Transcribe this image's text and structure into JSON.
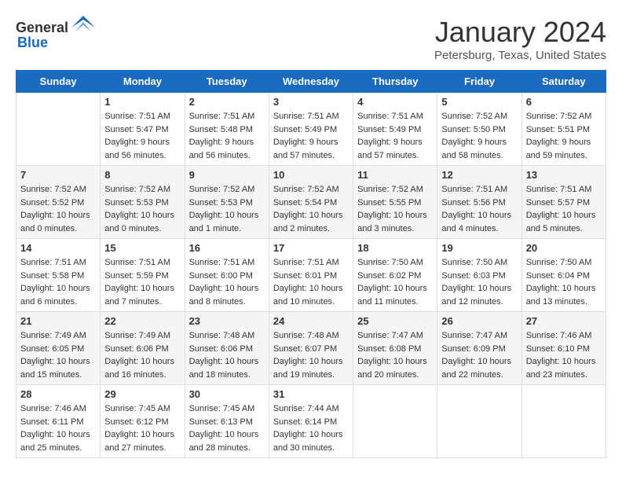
{
  "header": {
    "logo_general": "General",
    "logo_blue": "Blue",
    "month": "January 2024",
    "location": "Petersburg, Texas, United States"
  },
  "days_of_week": [
    "Sunday",
    "Monday",
    "Tuesday",
    "Wednesday",
    "Thursday",
    "Friday",
    "Saturday"
  ],
  "weeks": [
    [
      {
        "day": "",
        "content": ""
      },
      {
        "day": "1",
        "content": "Sunrise: 7:51 AM\nSunset: 5:47 PM\nDaylight: 9 hours\nand 56 minutes."
      },
      {
        "day": "2",
        "content": "Sunrise: 7:51 AM\nSunset: 5:48 PM\nDaylight: 9 hours\nand 56 minutes."
      },
      {
        "day": "3",
        "content": "Sunrise: 7:51 AM\nSunset: 5:49 PM\nDaylight: 9 hours\nand 57 minutes."
      },
      {
        "day": "4",
        "content": "Sunrise: 7:51 AM\nSunset: 5:49 PM\nDaylight: 9 hours\nand 57 minutes."
      },
      {
        "day": "5",
        "content": "Sunrise: 7:52 AM\nSunset: 5:50 PM\nDaylight: 9 hours\nand 58 minutes."
      },
      {
        "day": "6",
        "content": "Sunrise: 7:52 AM\nSunset: 5:51 PM\nDaylight: 9 hours\nand 59 minutes."
      }
    ],
    [
      {
        "day": "7",
        "content": "Sunrise: 7:52 AM\nSunset: 5:52 PM\nDaylight: 10 hours\nand 0 minutes."
      },
      {
        "day": "8",
        "content": "Sunrise: 7:52 AM\nSunset: 5:53 PM\nDaylight: 10 hours\nand 0 minutes."
      },
      {
        "day": "9",
        "content": "Sunrise: 7:52 AM\nSunset: 5:53 PM\nDaylight: 10 hours\nand 1 minute."
      },
      {
        "day": "10",
        "content": "Sunrise: 7:52 AM\nSunset: 5:54 PM\nDaylight: 10 hours\nand 2 minutes."
      },
      {
        "day": "11",
        "content": "Sunrise: 7:52 AM\nSunset: 5:55 PM\nDaylight: 10 hours\nand 3 minutes."
      },
      {
        "day": "12",
        "content": "Sunrise: 7:51 AM\nSunset: 5:56 PM\nDaylight: 10 hours\nand 4 minutes."
      },
      {
        "day": "13",
        "content": "Sunrise: 7:51 AM\nSunset: 5:57 PM\nDaylight: 10 hours\nand 5 minutes."
      }
    ],
    [
      {
        "day": "14",
        "content": "Sunrise: 7:51 AM\nSunset: 5:58 PM\nDaylight: 10 hours\nand 6 minutes."
      },
      {
        "day": "15",
        "content": "Sunrise: 7:51 AM\nSunset: 5:59 PM\nDaylight: 10 hours\nand 7 minutes."
      },
      {
        "day": "16",
        "content": "Sunrise: 7:51 AM\nSunset: 6:00 PM\nDaylight: 10 hours\nand 8 minutes."
      },
      {
        "day": "17",
        "content": "Sunrise: 7:51 AM\nSunset: 6:01 PM\nDaylight: 10 hours\nand 10 minutes."
      },
      {
        "day": "18",
        "content": "Sunrise: 7:50 AM\nSunset: 6:02 PM\nDaylight: 10 hours\nand 11 minutes."
      },
      {
        "day": "19",
        "content": "Sunrise: 7:50 AM\nSunset: 6:03 PM\nDaylight: 10 hours\nand 12 minutes."
      },
      {
        "day": "20",
        "content": "Sunrise: 7:50 AM\nSunset: 6:04 PM\nDaylight: 10 hours\nand 13 minutes."
      }
    ],
    [
      {
        "day": "21",
        "content": "Sunrise: 7:49 AM\nSunset: 6:05 PM\nDaylight: 10 hours\nand 15 minutes."
      },
      {
        "day": "22",
        "content": "Sunrise: 7:49 AM\nSunset: 6:06 PM\nDaylight: 10 hours\nand 16 minutes."
      },
      {
        "day": "23",
        "content": "Sunrise: 7:48 AM\nSunset: 6:06 PM\nDaylight: 10 hours\nand 18 minutes."
      },
      {
        "day": "24",
        "content": "Sunrise: 7:48 AM\nSunset: 6:07 PM\nDaylight: 10 hours\nand 19 minutes."
      },
      {
        "day": "25",
        "content": "Sunrise: 7:47 AM\nSunset: 6:08 PM\nDaylight: 10 hours\nand 20 minutes."
      },
      {
        "day": "26",
        "content": "Sunrise: 7:47 AM\nSunset: 6:09 PM\nDaylight: 10 hours\nand 22 minutes."
      },
      {
        "day": "27",
        "content": "Sunrise: 7:46 AM\nSunset: 6:10 PM\nDaylight: 10 hours\nand 23 minutes."
      }
    ],
    [
      {
        "day": "28",
        "content": "Sunrise: 7:46 AM\nSunset: 6:11 PM\nDaylight: 10 hours\nand 25 minutes."
      },
      {
        "day": "29",
        "content": "Sunrise: 7:45 AM\nSunset: 6:12 PM\nDaylight: 10 hours\nand 27 minutes."
      },
      {
        "day": "30",
        "content": "Sunrise: 7:45 AM\nSunset: 6:13 PM\nDaylight: 10 hours\nand 28 minutes."
      },
      {
        "day": "31",
        "content": "Sunrise: 7:44 AM\nSunset: 6:14 PM\nDaylight: 10 hours\nand 30 minutes."
      },
      {
        "day": "",
        "content": ""
      },
      {
        "day": "",
        "content": ""
      },
      {
        "day": "",
        "content": ""
      }
    ]
  ]
}
